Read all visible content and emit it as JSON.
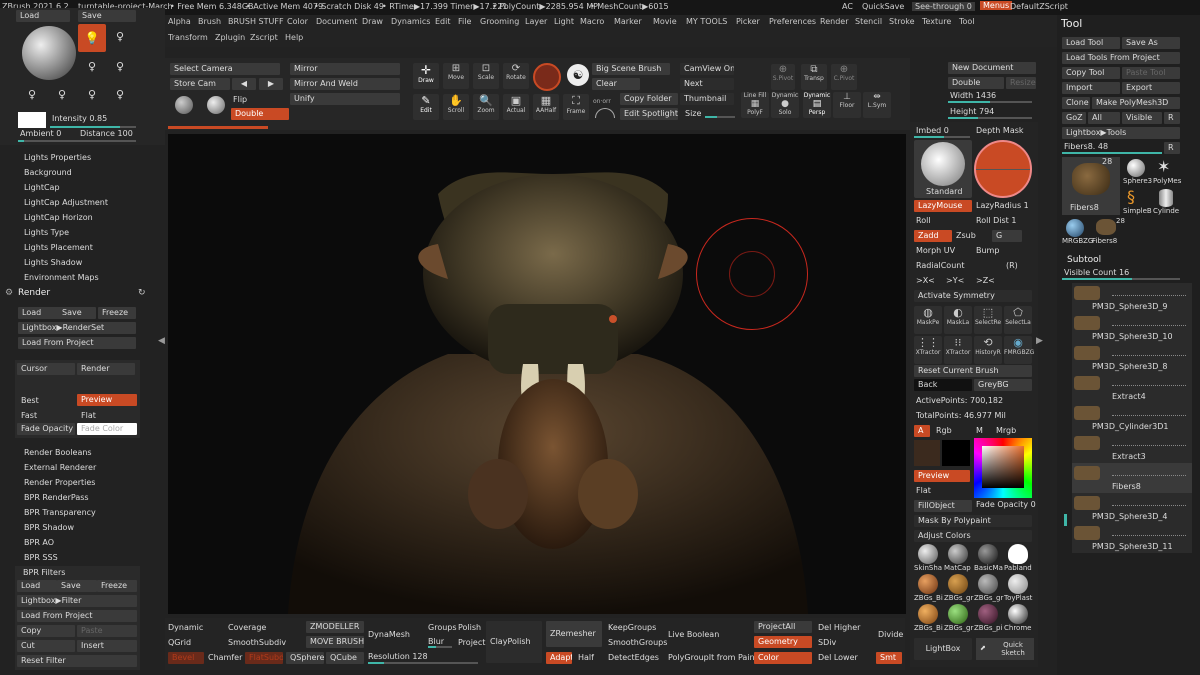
{
  "titlebar": {
    "app": "ZBrush 2021.6.2",
    "project": "turntable-project-March",
    "free_mem": "• Free Mem 6.348GB",
    "active_mem": "• Active Mem 4079",
    "scratch": "• Scratch Disk 49",
    "rtime": "• RTime▶17.399 Timer▶17.221",
    "polycount": "• PolyCount▶2285.954 MP",
    "meshcount": "• MeshCount▶6015",
    "ac": "AC",
    "quicksave": "QuickSave",
    "see_through": "See-through",
    "see_through_val": "0",
    "menus": "Menus",
    "script": "DefaultZScript"
  },
  "menubar": {
    "row1": [
      "Alpha",
      "Brush",
      "BRUSH STUFF",
      "Color",
      "Document",
      "Draw",
      "Dynamics",
      "Edit",
      "File",
      "Grooming",
      "Layer",
      "Light",
      "Macro",
      "Marker",
      "Movie",
      "MY TOOLS",
      "Picker",
      "Preferences",
      "Render",
      "Stencil",
      "Stroke",
      "Texture",
      "Tool"
    ],
    "row2": [
      "Transform",
      "Zplugin",
      "Zscript",
      "Help"
    ]
  },
  "left_top": {
    "load": "Load",
    "save": "Save",
    "intensity": "Intensity 0.85",
    "ambient": "Ambient 0",
    "distance": "Distance 100"
  },
  "light_menu": [
    "Lights Properties",
    "Background",
    "LightCap",
    "LightCap Adjustment",
    "LightCap Horizon",
    "Lights Type",
    "Lights Placement",
    "Lights Shadow",
    "Environment Maps"
  ],
  "render": {
    "title": "Render",
    "load": "Load",
    "save": "Save",
    "freeze": "Freeze",
    "lightbox": "Lightbox▶RenderSet",
    "load_project": "Load From Project",
    "cursor": "Cursor",
    "render": "Render",
    "best": "Best",
    "preview": "Preview",
    "fast": "Fast",
    "flat": "Flat",
    "fade_opacity": "Fade Opacity 0",
    "fade_color": "Fade Color",
    "items": [
      "Render Booleans",
      "External Renderer",
      "Render Properties",
      "BPR RenderPass",
      "BPR Transparency",
      "BPR Shadow",
      "BPR AO",
      "BPR SSS"
    ],
    "filters": "BPR Filters",
    "f_load": "Load",
    "f_save": "Save",
    "f_freeze": "Freeze",
    "f_lightbox": "Lightbox▶Filter",
    "f_loadproj": "Load From Project",
    "copy": "Copy",
    "paste": "Paste",
    "cut": "Cut",
    "insert": "Insert",
    "reset": "Reset Filter"
  },
  "toolbar": {
    "select_camera": "Select Camera",
    "store_cam": "Store Cam",
    "mirror": "Mirror",
    "mirror_weld": "Mirror And Weld",
    "unify": "Unify",
    "flip": "Flip",
    "double": "Double",
    "draw": "Draw",
    "move": "Move",
    "scale": "Scale",
    "rotate": "Rotate",
    "edit": "Edit",
    "scroll": "Scroll",
    "zoom": "Zoom",
    "actual": "Actual",
    "aahalf": "AAHalf",
    "frame": "Frame",
    "big_scene": "Big Scene Brush",
    "clear": "Clear",
    "copy_folder": "Copy Folder",
    "edit_spotlight": "Edit Spotlight",
    "camview": "CamView On",
    "next": "Next",
    "thumbnail": "Thumbnail",
    "size": "Size",
    "spivot": "S.Pivot",
    "transp": "Transp",
    "cpivot": "C.Pivot",
    "linefill": "Line Fill",
    "polyf": "PolyF",
    "dynamic": "Dynamic",
    "solo": "Solo",
    "persp_dyn": "Dynamic",
    "persp": "Persp",
    "floor": "Floor",
    "lsym": "L.Sym",
    "new_doc": "New Document",
    "double_doc": "Double",
    "resize": "Resize",
    "width": "Width 1436",
    "height": "Height 794"
  },
  "brushpanel": {
    "imbed": "Imbed 0",
    "depth_mask": "Depth Mask",
    "standard": "Standard",
    "lazymouse": "LazyMouse",
    "lazyradius": "LazyRadius 1",
    "roll": "Roll",
    "roll_dist": "Roll Dist 1",
    "zadd": "Zadd",
    "zsub": "Zsub",
    "g": "G",
    "morph_uv": "Morph UV",
    "bump": "Bump",
    "radialcount": "RadialCount",
    "r": "(R)",
    "sym_x": ">X<",
    "sym_y": ">Y<",
    "sym_z": ">Z<",
    "activate_sym": "Activate Symmetry",
    "icons": [
      "MaskPe",
      "MaskLa",
      "SelectRe",
      "SelectLa",
      "XTractor",
      "XTractor",
      "HistoryR",
      "FMRGBZG"
    ],
    "reset_brush": "Reset Current Brush",
    "back": "Back",
    "greybg": "GreyBG",
    "active_points": "ActivePoints: 700,182",
    "total_points": "TotalPoints: 46.977 Mil",
    "a": "A",
    "rgb": "Rgb",
    "m": "M",
    "mrgb": "Mrgb",
    "preview": "Preview",
    "flat": "Flat",
    "fillobject": "FillObject",
    "fade_opacity": "Fade Opacity 0",
    "mask_polypaint": "Mask By Polypaint",
    "adjust_colors": "Adjust Colors",
    "materials": [
      "SkinSha",
      "MatCap",
      "BasicMa",
      "Pabland",
      "ZBGs_Bi",
      "ZBGs_gr",
      "ZBGs_gr",
      "ToyPlast",
      "ZBGs_Bi",
      "ZBGs_gr",
      "ZBGs_pi",
      "Chrome"
    ],
    "lightbox": "LightBox",
    "quick_sketch": "Quick Sketch"
  },
  "bottom": {
    "dynamic": "Dynamic",
    "coverage": "Coverage",
    "qgrid": "QGrid",
    "smoothsubdiv": "SmoothSubdiv",
    "bevel": "Bevel",
    "chamfer": "Chamfer",
    "flatsubdiv": "FlatSubdiv",
    "zmodeller": "ZMODELLER",
    "move_brush": "MOVE BRUSH",
    "qsphere": "QSphere",
    "qcube": "QCube",
    "dynamesh": "DynaMesh",
    "groups": "Groups",
    "polish": "Polish",
    "blur": "Blur",
    "project": "Project",
    "resolution": "Resolution 128",
    "claypolish": "ClayPolish",
    "zremesher": "ZRemesher",
    "adapt": "Adapt",
    "half": "Half",
    "keepgroups": "KeepGroups",
    "smoothgroups": "SmoothGroups",
    "detectedges": "DetectEdges",
    "live_boolean": "Live Boolean",
    "polygroup_paint": "PolyGroupIt from Paint",
    "projectall": "ProjectAll",
    "del_higher": "Del Higher",
    "geometry": "Geometry",
    "sdiv": "SDiv",
    "color": "Color",
    "del_lower": "Del Lower",
    "divide": "Divide",
    "smt": "Smt"
  },
  "tool": {
    "title": "Tool",
    "load_tool": "Load Tool",
    "save_as": "Save As",
    "load_from_project": "Load Tools From Project",
    "copy_tool": "Copy Tool",
    "paste_tool": "Paste Tool",
    "import": "Import",
    "export": "Export",
    "clone": "Clone",
    "make_polymesh": "Make PolyMesh3D",
    "goz": "GoZ",
    "all": "All",
    "visible": "Visible",
    "r": "R",
    "lightbox_tools": "Lightbox▶Tools",
    "fibers_current": "Fibers8. 48",
    "r2": "R",
    "count": "28",
    "thumbs": [
      "Fibers8",
      "Sphere3",
      "PolyMes",
      "SimpleB",
      "Cylinde",
      "MRGBZG",
      "Fibers8"
    ],
    "thumb_count": "28"
  },
  "subtool": {
    "title": "Subtool",
    "visible_count": "Visible Count 16",
    "items": [
      "PM3D_Sphere3D_9",
      "PM3D_Sphere3D_10",
      "PM3D_Sphere3D_8",
      "Extract4",
      "PM3D_Cylinder3D1",
      "Extract3",
      "Fibers8",
      "PM3D_Sphere3D_4",
      "PM3D_Sphere3D_11"
    ]
  }
}
